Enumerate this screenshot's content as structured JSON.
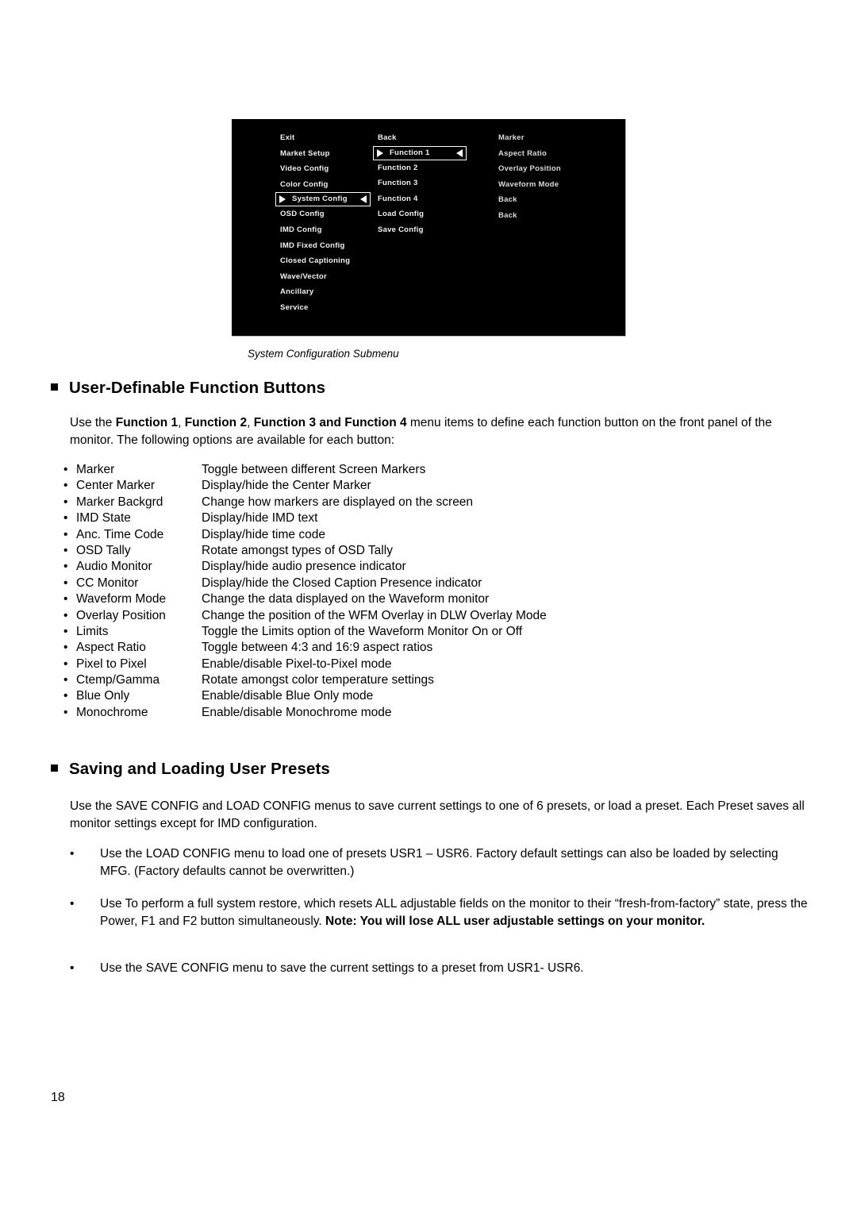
{
  "page": {
    "number": "18"
  },
  "figure": {
    "caption": "System Configuration Submenu",
    "osd": {
      "columns": [
        {
          "name": "main-menu-column",
          "items": [
            {
              "label": "Exit",
              "selected": false
            },
            {
              "label": "Market Setup",
              "selected": false
            },
            {
              "label": "Video Config",
              "selected": false
            },
            {
              "label": "Color Config",
              "selected": false
            },
            {
              "label": "System Config",
              "selected": true
            },
            {
              "label": "OSD Config",
              "selected": false
            },
            {
              "label": "IMD Config",
              "selected": false
            },
            {
              "label": "IMD Fixed Config",
              "selected": false
            },
            {
              "label": "Closed Captioning",
              "selected": false
            },
            {
              "label": "Wave/Vector",
              "selected": false
            },
            {
              "label": "Ancillary",
              "selected": false
            },
            {
              "label": "Service",
              "selected": false
            }
          ]
        },
        {
          "name": "system-config-column",
          "items": [
            {
              "label": "Back",
              "selected": false
            },
            {
              "label": "Function 1",
              "selected": true
            },
            {
              "label": "Function 2",
              "selected": false
            },
            {
              "label": "Function 3",
              "selected": false
            },
            {
              "label": "Function 4",
              "selected": false
            },
            {
              "label": "Load Config",
              "selected": false
            },
            {
              "label": "Save Config",
              "selected": false
            }
          ]
        },
        {
          "name": "function-options-column",
          "items": [
            {
              "label": "Marker",
              "selected": false
            },
            {
              "label": "Aspect Ratio",
              "selected": false
            },
            {
              "label": "Overlay Position",
              "selected": false
            },
            {
              "label": "Waveform Mode",
              "selected": false
            },
            {
              "label": "Back",
              "selected": false
            },
            {
              "label": "Back",
              "selected": false
            }
          ]
        }
      ]
    }
  },
  "sections": {
    "function_buttons": {
      "heading": "User-Definable Function Buttons",
      "intro_parts": [
        {
          "text": "Use the ",
          "bold": false
        },
        {
          "text": "Function 1",
          "bold": true
        },
        {
          "text": ", ",
          "bold": false
        },
        {
          "text": "Function 2",
          "bold": true
        },
        {
          "text": ", ",
          "bold": false
        },
        {
          "text": "Function 3 and Function 4",
          "bold": true
        },
        {
          "text": " menu items to define each function button on the front panel of the monitor. The following options are available for each button:",
          "bold": false
        }
      ],
      "bullet_char": "•",
      "options": [
        {
          "name": "Marker",
          "description": "Toggle between different Screen Markers"
        },
        {
          "name": "Center Marker",
          "description": "Display/hide the Center Marker"
        },
        {
          "name": "Marker Backgrd",
          "description": "Change how markers are displayed on the screen"
        },
        {
          "name": "IMD State",
          "description": "Display/hide IMD text"
        },
        {
          "name": "Anc. Time Code",
          "description": "Display/hide time code"
        },
        {
          "name": "OSD Tally",
          "description": "Rotate amongst types of OSD Tally"
        },
        {
          "name": "Audio Monitor",
          "description": "Display/hide audio presence indicator"
        },
        {
          "name": "CC Monitor",
          "description": "Display/hide the Closed Caption Presence indicator"
        },
        {
          "name": "Waveform Mode",
          "description": "Change the data displayed on the Waveform monitor"
        },
        {
          "name": "Overlay Position",
          "description": "Change the position of the WFM Overlay in DLW Overlay Mode"
        },
        {
          "name": "Limits",
          "description": "Toggle the Limits option of the Waveform Monitor On or Off"
        },
        {
          "name": "Aspect Ratio",
          "description": "Toggle between 4:3 and 16:9 aspect ratios"
        },
        {
          "name": "Pixel to Pixel",
          "description": "Enable/disable Pixel-to-Pixel mode"
        },
        {
          "name": "Ctemp/Gamma",
          "description": "Rotate amongst color temperature settings"
        },
        {
          "name": "Blue Only",
          "description": "Enable/disable Blue Only mode"
        },
        {
          "name": "Monochrome",
          "description": "Enable/disable Monochrome mode"
        }
      ]
    },
    "user_presets": {
      "heading": "Saving and Loading User Presets",
      "intro": "Use the SAVE CONFIG and LOAD CONFIG menus to save current settings to one of 6 presets, or load a preset. Each Preset saves all monitor settings except for IMD configuration.",
      "bullet_char": "•",
      "bullets": [
        {
          "parts": [
            {
              "text": "Use the LOAD CONFIG menu to load one of presets USR1 – USR6. Factory default settings can also be loaded by selecting MFG. (Factory defaults cannot be overwritten.)",
              "bold": false
            }
          ]
        },
        {
          "parts": [
            {
              "text": "Use To perform a full system restore, which resets ALL adjustable fields on the monitor to their “fresh-from-factory” state, press the Power, F1 and F2 button simultaneously.  ",
              "bold": false
            },
            {
              "text": "Note: You will lose ALL user adjustable settings on your monitor.",
              "bold": true
            }
          ]
        },
        {
          "parts": [
            {
              "text": "Use the SAVE CONFIG menu to save the current settings to a preset from USR1- USR6.",
              "bold": false
            }
          ]
        }
      ]
    }
  }
}
